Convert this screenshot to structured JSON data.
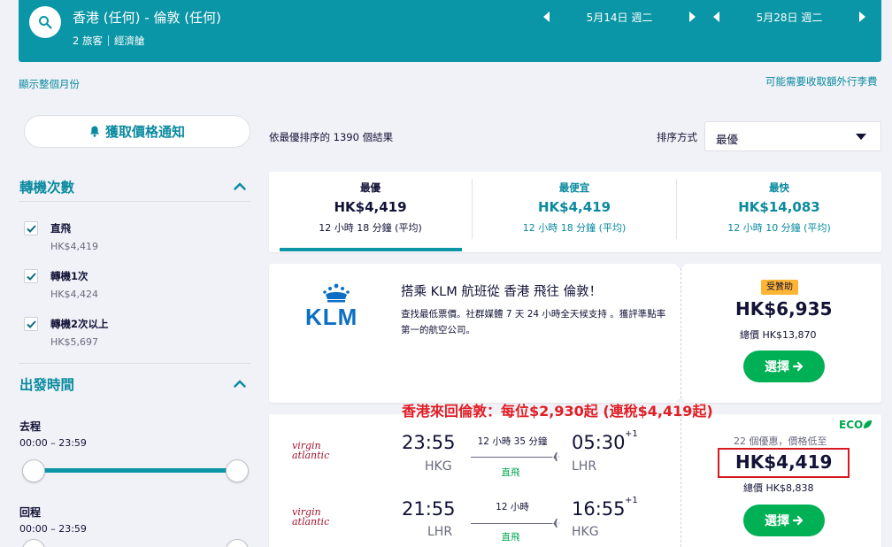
{
  "search": {
    "route": "香港 (任何) - 倫敦 (任何)",
    "travellers": "2 旅客",
    "cabin": "經濟艙",
    "depart_date": "5月14日 週二",
    "return_date": "5月28日 週二"
  },
  "links": {
    "show_month": "顯示整個月份",
    "bag_fees": "可能需要收取額外行李費"
  },
  "sidebar": {
    "price_alert": "獲取價格通知",
    "stops_title": "轉機次數",
    "stops": [
      {
        "label": "直飛",
        "price": "HK$4,419"
      },
      {
        "label": "轉機1次",
        "price": "HK$4,424"
      },
      {
        "label": "轉機2次以上",
        "price": "HK$5,697"
      }
    ],
    "times_title": "出發時間",
    "outbound_label": "去程",
    "outbound_range": "00:00 – 23:59",
    "return_label": "回程",
    "return_range": "00:00 – 23:59"
  },
  "results": {
    "count_text": "依最優排序的 1390 個結果",
    "sort_label": "排序方式",
    "sort_value": "最優"
  },
  "tabs": [
    {
      "title": "最優",
      "price": "HK$4,419",
      "duration": "12 小時 18 分鐘 (平均)"
    },
    {
      "title": "最便宜",
      "price": "HK$4,419",
      "duration": "12 小時 18 分鐘 (平均)"
    },
    {
      "title": "最快",
      "price": "HK$14,083",
      "duration": "12 小時 10 分鐘 (平均)"
    }
  ],
  "ad": {
    "logo": "KLM",
    "title": "搭乘 KLM 航班從 香港 飛往 倫敦！",
    "description": "查找最低票價。社群媒體 7 天 24 小時全天候支持 。獲評準點率第一的航空公司。",
    "badge": "受贊助",
    "price": "HK$6,935",
    "total": "總價 HK$13,870",
    "select_label": "選擇"
  },
  "annotation": "香港來回倫敦：每位$2,930起 (連稅$4,419起)",
  "flight": {
    "airline_logo": [
      "virgin",
      "atlantic"
    ],
    "eco": "ECO",
    "deals": "22 個優惠，價格低至",
    "price": "HK$4,419",
    "total": "總價 HK$8,838",
    "select_label": "選擇",
    "legs": [
      {
        "depart": "23:55",
        "from": "HKG",
        "duration": "12 小時 35 分鐘",
        "stops": "直飛",
        "arrive": "05:30",
        "to": "LHR",
        "plus": "+1"
      },
      {
        "depart": "21:55",
        "from": "LHR",
        "duration": "12 小時",
        "stops": "直飛",
        "arrive": "16:55",
        "to": "HKG",
        "plus": "+1"
      }
    ]
  },
  "colors": {
    "header": "#0a96a6",
    "accent": "#0a8aa0",
    "select_green": "#00b055",
    "sponsor_badge": "#ffb534",
    "annotation_red": "#e01e24"
  }
}
